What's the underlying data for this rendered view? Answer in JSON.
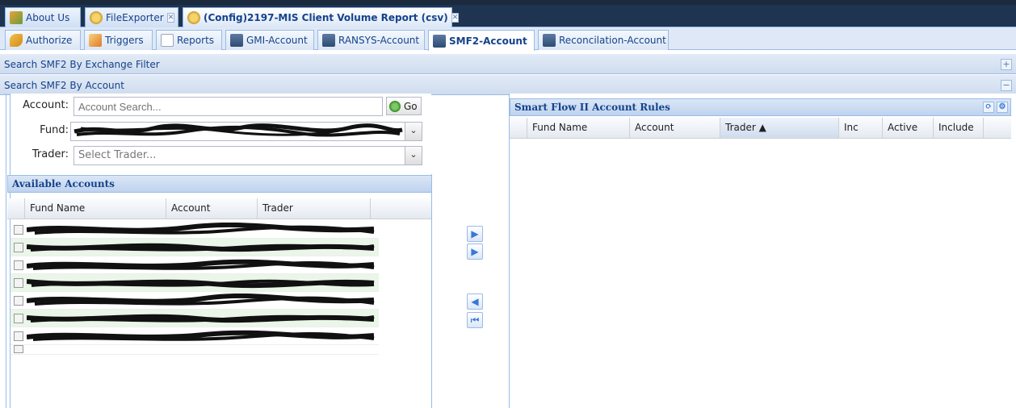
{
  "top_tabs": [
    {
      "label": "About Us",
      "icon": "people-icon"
    },
    {
      "label": "FileExporter",
      "icon": "gear-icon",
      "closable": true
    },
    {
      "label": "(Config)2197-MIS Client Volume Report (csv)",
      "icon": "gear-icon",
      "closable": true,
      "active": true
    }
  ],
  "sub_tabs": [
    {
      "label": "Authorize",
      "icon": "key-icon"
    },
    {
      "label": "Triggers",
      "icon": "trigger-icon"
    },
    {
      "label": "Reports",
      "icon": "copy-icon"
    },
    {
      "label": "GMI-Account",
      "icon": "page-icon"
    },
    {
      "label": "RANSYS-Account",
      "icon": "page-icon"
    },
    {
      "label": "SMF2-Account",
      "icon": "page-icon",
      "active": true
    },
    {
      "label": "Reconcilation-Account",
      "icon": "page-icon"
    }
  ],
  "sections": {
    "exchange_filter": "Search SMF2 By Exchange Filter",
    "by_account": "Search SMF2 By Account"
  },
  "form": {
    "account_label": "Account:",
    "account_placeholder": "Account Search...",
    "go_label": "Go",
    "fund_label": "Fund:",
    "trader_label": "Trader:",
    "trader_placeholder": "Select Trader..."
  },
  "available_accounts": {
    "title": "Available Accounts",
    "columns": [
      "Fund Name",
      "Account",
      "Trader"
    ],
    "row_count_visible": 8
  },
  "rules_panel": {
    "title": "Smart Flow II Account Rules",
    "columns": [
      "Fund Name",
      "Account",
      "Trader ▲",
      "Inc",
      "Active",
      "Include"
    ]
  },
  "colors": {
    "header_dark": "#1e3450",
    "panel_blue": "#99bbe8",
    "title_text": "#15428b",
    "row_alt": "#eaf6e8"
  }
}
